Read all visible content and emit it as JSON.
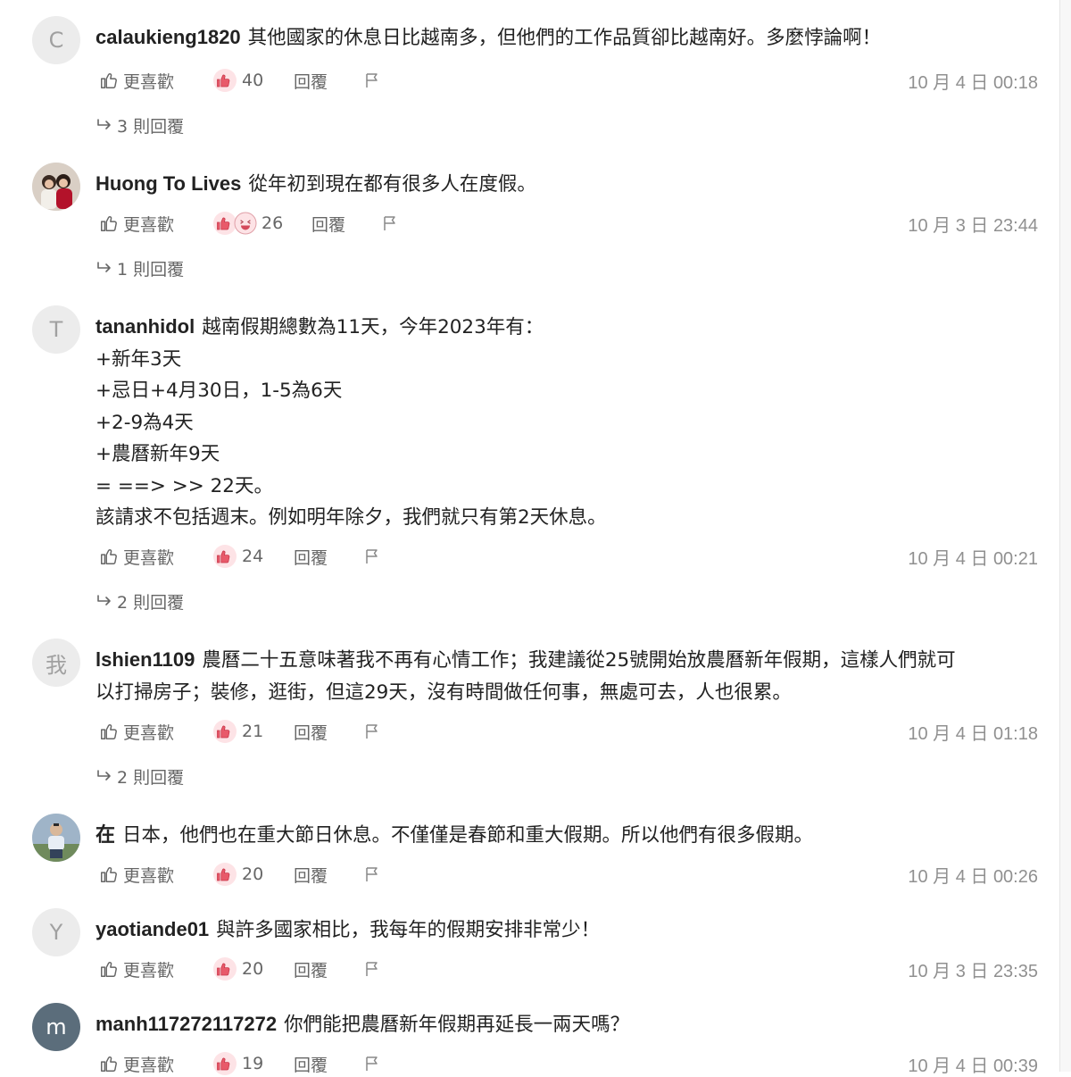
{
  "actions": {
    "like_label": "更喜歡",
    "reply_label": "回覆"
  },
  "comments": [
    {
      "avatar_letter": "C",
      "user": "calaukieng1820",
      "lines": [
        "其他國家的休息日比越南多，但他們的工作品質卻比越南好。多麼悖論啊！"
      ],
      "reactions": "40",
      "reaction_icons": [
        "thumbs-up-icon"
      ],
      "timestamp": "10 月 4 日 00:18",
      "replies": "3 則回覆"
    },
    {
      "avatar_letter": "",
      "user": "Huong To Lives",
      "lines": [
        "從年初到現在都有很多人在度假。"
      ],
      "reactions": "26",
      "reaction_icons": [
        "thumbs-up-icon",
        "laugh-icon"
      ],
      "timestamp": "10 月 3 日 23:44",
      "replies": "1 則回覆"
    },
    {
      "avatar_letter": "T",
      "user": "tananhidol",
      "lines": [
        "越南假期總數為11天，今年2023年有：",
        "+新年3天",
        "+忌日+4月30日，1-5為6天",
        "+2-9為4天",
        "+農曆新年9天",
        "= ==> >> 22天。",
        "該請求不包括週末。例如明年除夕，我們就只有第2天休息。"
      ],
      "reactions": "24",
      "reaction_icons": [
        "thumbs-up-icon"
      ],
      "timestamp": "10 月 4 日 00:21",
      "replies": "2 則回覆"
    },
    {
      "avatar_letter": "我",
      "user": "lshien1109",
      "lines": [
        "農曆二十五意味著我不再有心情工作；我建議從25號開始放農曆新年假期，這樣人們就可",
        "以打掃房子；裝修，逛街，但這29天，沒有時間做任何事，無處可去，人也很累。"
      ],
      "reactions": "21",
      "reaction_icons": [
        "thumbs-up-icon"
      ],
      "timestamp": "10 月 4 日 01:18",
      "replies": "2 則回覆"
    },
    {
      "avatar_letter": "",
      "user": "在",
      "lines": [
        "日本，他們也在重大節日休息。不僅僅是春節和重大假期。所以他們有很多假期。"
      ],
      "reactions": "20",
      "reaction_icons": [
        "thumbs-up-icon"
      ],
      "timestamp": "10 月 4 日 00:26",
      "replies": ""
    },
    {
      "avatar_letter": "Y",
      "user": "yaotiande01",
      "lines": [
        "與許多國家相比，我每年的假期安排非常少！"
      ],
      "reactions": "20",
      "reaction_icons": [
        "thumbs-up-icon"
      ],
      "timestamp": "10 月 3 日 23:35",
      "replies": ""
    },
    {
      "avatar_letter": "m",
      "user": "manh117272117272",
      "lines": [
        "你們能把農曆新年假期再延長一兩天嗎？"
      ],
      "reactions": "19",
      "reaction_icons": [
        "thumbs-up-icon"
      ],
      "timestamp": "10 月 4 日 00:39",
      "replies": ""
    }
  ]
}
